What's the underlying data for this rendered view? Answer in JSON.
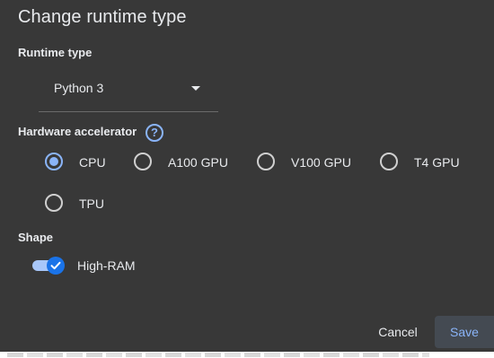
{
  "dialog": {
    "title": "Change runtime type",
    "runtime_type": {
      "label": "Runtime type",
      "selected": "Python 3"
    },
    "hardware_accelerator": {
      "label": "Hardware accelerator",
      "help_icon": "?",
      "options": [
        {
          "label": "CPU",
          "checked": true
        },
        {
          "label": "A100 GPU",
          "checked": false
        },
        {
          "label": "V100 GPU",
          "checked": false
        },
        {
          "label": "T4 GPU",
          "checked": false
        },
        {
          "label": "TPU",
          "checked": false
        }
      ]
    },
    "shape": {
      "label": "Shape",
      "high_ram": {
        "label": "High-RAM",
        "enabled": true
      }
    },
    "buttons": {
      "cancel": "Cancel",
      "save": "Save"
    }
  },
  "colors": {
    "dialog_bg": "#383838",
    "accent": "#8ab4f8",
    "toggle_thumb": "#1a73e8",
    "text": "#e8eaed"
  }
}
